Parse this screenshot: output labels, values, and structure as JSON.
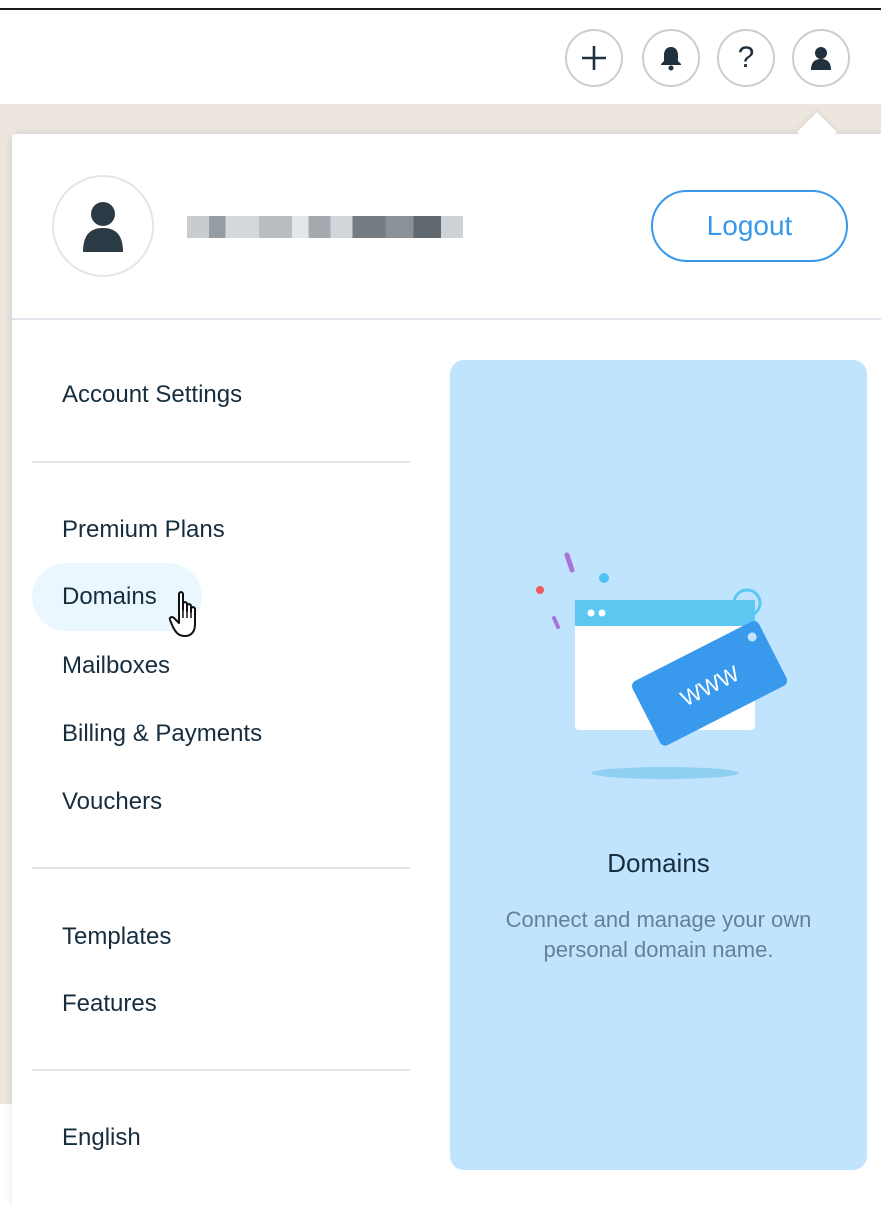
{
  "topbar": {
    "icons": [
      "plus-icon",
      "bell-icon",
      "help-icon",
      "user-icon"
    ],
    "help_glyph": "?"
  },
  "account": {
    "logout_label": "Logout"
  },
  "menu": {
    "section1": [
      "Account Settings"
    ],
    "section2": [
      "Premium Plans",
      "Domains",
      "Mailboxes",
      "Billing & Payments",
      "Vouchers"
    ],
    "section3": [
      "Templates",
      "Features"
    ],
    "section4": [
      "English"
    ],
    "hovered_item": "Domains"
  },
  "promo": {
    "illustration_text": "WWW",
    "title": "Domains",
    "description": "Connect and manage your own personal domain name."
  },
  "colors": {
    "accent": "#3899ec",
    "promo_bg": "#c1e4fe",
    "hover_bg": "#eaf7ff",
    "text": "#162d3d",
    "muted_text": "#677f94"
  }
}
